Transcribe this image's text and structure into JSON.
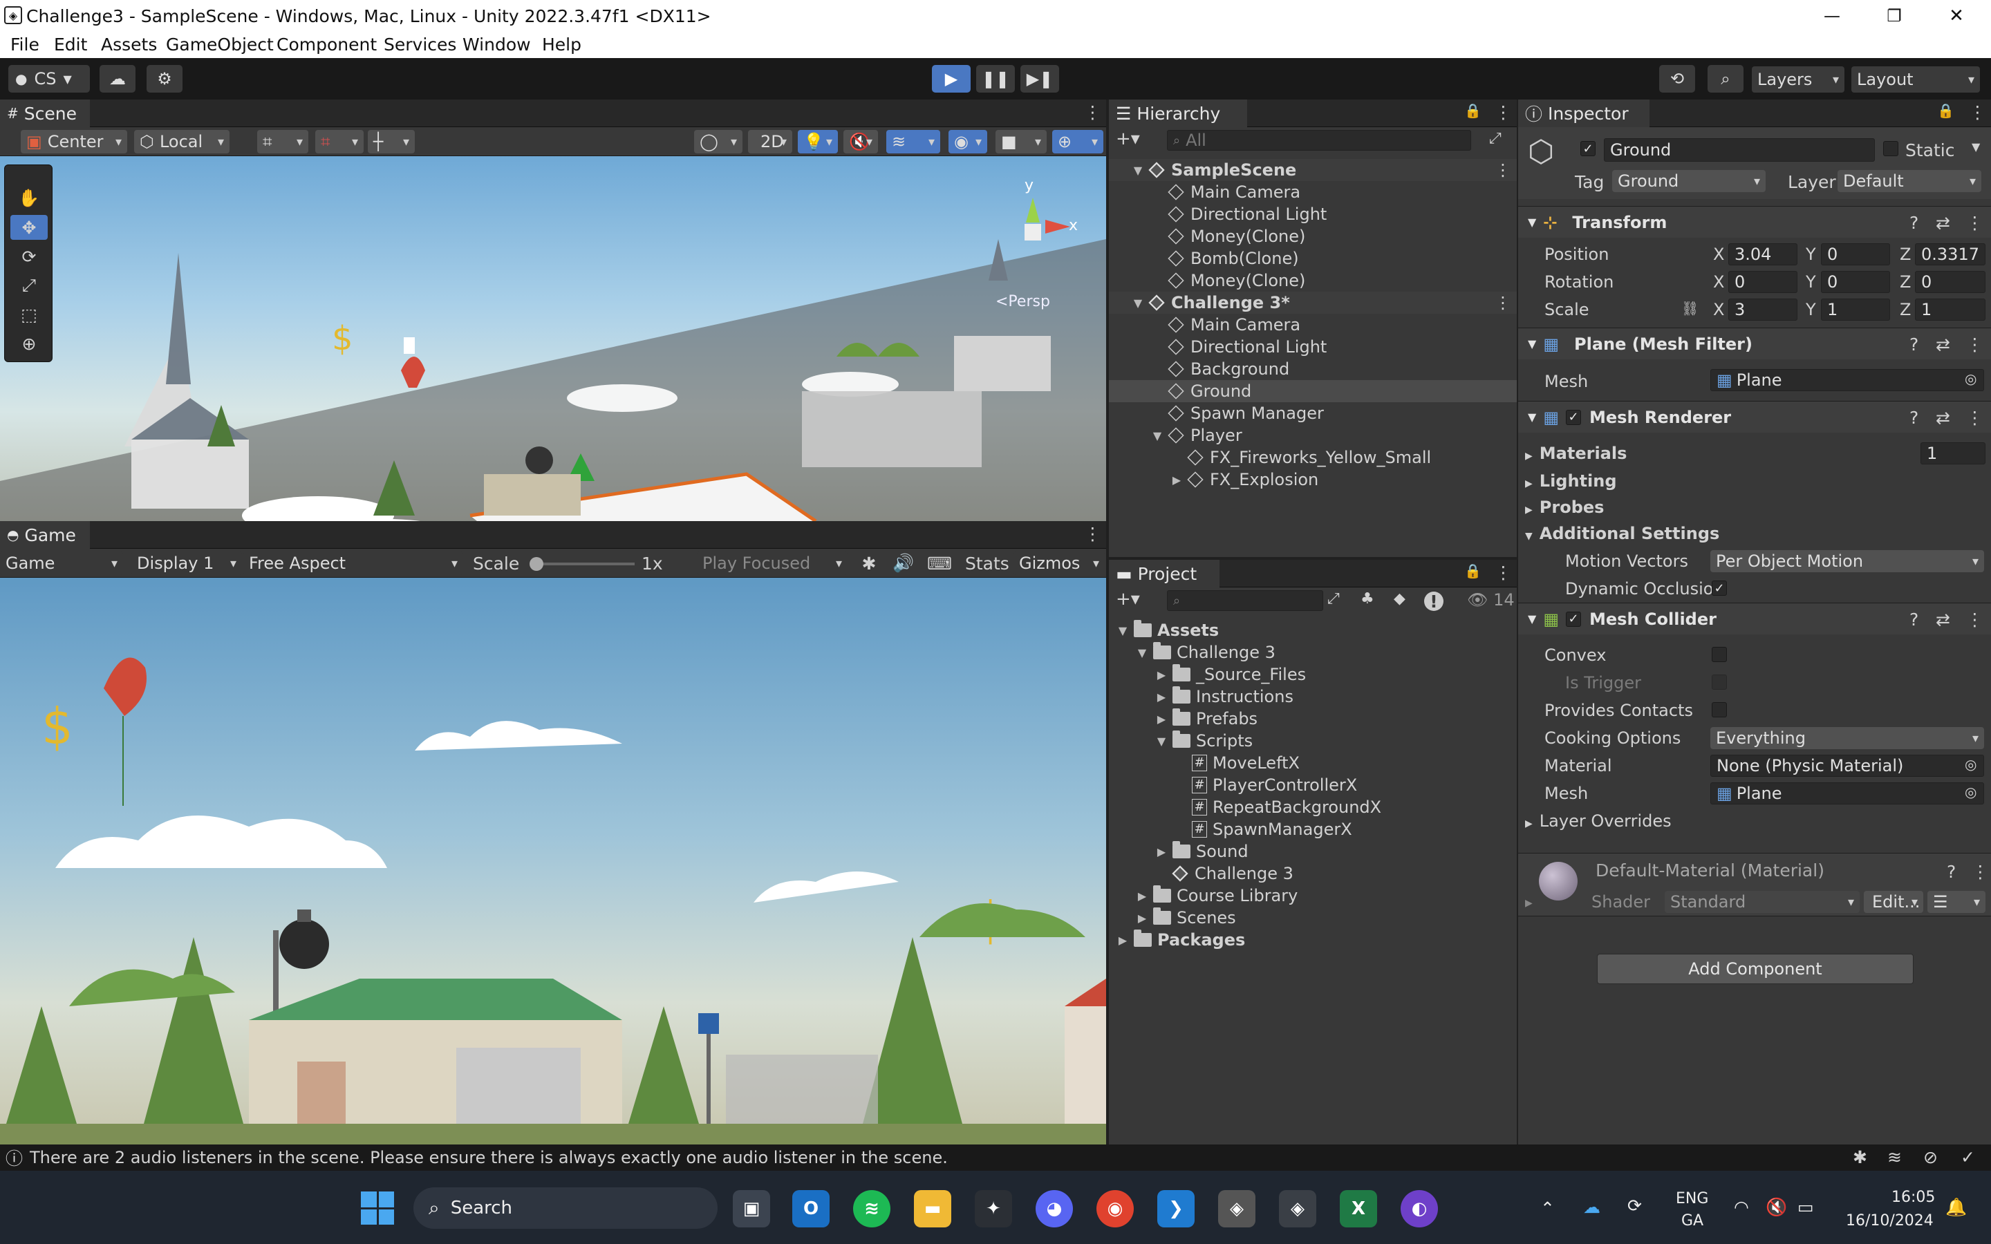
{
  "window": {
    "title": "Challenge3 - SampleScene - Windows, Mac, Linux - Unity 2022.3.47f1 <DX11>",
    "controls": [
      "—",
      "❐",
      "✕"
    ]
  },
  "menu": [
    "File",
    "Edit",
    "Assets",
    "GameObject",
    "Component",
    "Services",
    "Window",
    "Help"
  ],
  "toolbar": {
    "account": "CS",
    "layers": "Layers",
    "layout": "Layout"
  },
  "scene_panel": {
    "tab": "Scene",
    "pivot": "Center",
    "space": "Local",
    "mode_2d": "2D",
    "persp": "<Persp",
    "axis_y": "y",
    "axis_x": "x"
  },
  "game_panel": {
    "tab": "Game",
    "view": "Game",
    "display": "Display 1",
    "aspect": "Free Aspect",
    "scale_label": "Scale",
    "scale_value": "1x",
    "play_focus": "Play Focused",
    "stats": "Stats",
    "gizmos": "Gizmos"
  },
  "hierarchy": {
    "tab": "Hierarchy",
    "search_placeholder": "All",
    "items": [
      {
        "label": "SampleScene",
        "indent": 0,
        "scene": true,
        "expanded": true
      },
      {
        "label": "Main Camera",
        "indent": 1
      },
      {
        "label": "Directional Light",
        "indent": 1
      },
      {
        "label": "Money(Clone)",
        "indent": 1
      },
      {
        "label": "Bomb(Clone)",
        "indent": 1
      },
      {
        "label": "Money(Clone)",
        "indent": 1
      },
      {
        "label": "Challenge 3*",
        "indent": 0,
        "scene": true,
        "expanded": true
      },
      {
        "label": "Main Camera",
        "indent": 1
      },
      {
        "label": "Directional Light",
        "indent": 1
      },
      {
        "label": "Background",
        "indent": 1
      },
      {
        "label": "Ground",
        "indent": 1,
        "selected": true
      },
      {
        "label": "Spawn Manager",
        "indent": 1
      },
      {
        "label": "Player",
        "indent": 1,
        "expanded": true
      },
      {
        "label": "FX_Fireworks_Yellow_Small",
        "indent": 2
      },
      {
        "label": "FX_Explosion",
        "indent": 2,
        "collapsed": true
      }
    ]
  },
  "project": {
    "tab": "Project",
    "hidden_count": "14",
    "items": [
      {
        "label": "Assets",
        "indent": 0,
        "type": "folder",
        "bold": true,
        "expanded": true
      },
      {
        "label": "Challenge 3",
        "indent": 1,
        "type": "folder",
        "expanded": true
      },
      {
        "label": "_Source_Files",
        "indent": 2,
        "type": "folder",
        "collapsed": true
      },
      {
        "label": "Instructions",
        "indent": 2,
        "type": "folder",
        "collapsed": true
      },
      {
        "label": "Prefabs",
        "indent": 2,
        "type": "folder",
        "collapsed": true
      },
      {
        "label": "Scripts",
        "indent": 2,
        "type": "folder",
        "expanded": true
      },
      {
        "label": "MoveLeftX",
        "indent": 3,
        "type": "script"
      },
      {
        "label": "PlayerControllerX",
        "indent": 3,
        "type": "script"
      },
      {
        "label": "RepeatBackgroundX",
        "indent": 3,
        "type": "script"
      },
      {
        "label": "SpawnManagerX",
        "indent": 3,
        "type": "script"
      },
      {
        "label": "Sound",
        "indent": 2,
        "type": "folder",
        "collapsed": true
      },
      {
        "label": "Challenge 3",
        "indent": 2,
        "type": "scene"
      },
      {
        "label": "Course Library",
        "indent": 1,
        "type": "folder",
        "collapsed": true
      },
      {
        "label": "Scenes",
        "indent": 1,
        "type": "folder",
        "collapsed": true
      },
      {
        "label": "Packages",
        "indent": 0,
        "type": "folder",
        "bold": true,
        "collapsed": true
      }
    ]
  },
  "inspector": {
    "tab": "Inspector",
    "object_name": "Ground",
    "static_label": "Static",
    "tag_label": "Tag",
    "tag_value": "Ground",
    "layer_label": "Layer",
    "layer_value": "Default",
    "transform": {
      "title": "Transform",
      "position_label": "Position",
      "rotation_label": "Rotation",
      "scale_label": "Scale",
      "position": [
        "3.04",
        "0",
        "0.3317"
      ],
      "rotation": [
        "0",
        "0",
        "0"
      ],
      "scale": [
        "3",
        "1",
        "1"
      ]
    },
    "mesh_filter": {
      "title": "Plane (Mesh Filter)",
      "mesh_label": "Mesh",
      "mesh_value": "Plane"
    },
    "mesh_renderer": {
      "title": "Mesh Renderer",
      "materials": "Materials",
      "materials_count": "1",
      "lighting": "Lighting",
      "probes": "Probes",
      "additional": "Additional Settings",
      "motion_vectors_label": "Motion Vectors",
      "motion_vectors_value": "Per Object Motion",
      "dynamic_occlusion_label": "Dynamic Occlusio"
    },
    "mesh_collider": {
      "title": "Mesh Collider",
      "convex": "Convex",
      "is_trigger": "Is Trigger",
      "provides_contacts": "Provides Contacts",
      "cooking_label": "Cooking Options",
      "cooking_value": "Everything",
      "material_label": "Material",
      "material_value": "None (Physic Material)",
      "mesh_label": "Mesh",
      "mesh_value": "Plane",
      "layer_overrides": "Layer Overrides"
    },
    "material": {
      "title": "Default-Material (Material)",
      "shader_label": "Shader",
      "shader_value": "Standard",
      "edit": "Edit..."
    },
    "add_component": "Add Component"
  },
  "status": {
    "message": "There are 2 audio listeners in the scene. Please ensure there is always exactly one audio listener in the scene."
  },
  "taskbar": {
    "search": "Search",
    "lang_top": "ENG",
    "lang_bottom": "GA",
    "time": "16:05",
    "date": "16/10/2024"
  },
  "colors": {
    "accent_blue": "#4a78c2",
    "sky_top": "#6fa9d6",
    "sky_bottom": "#cfe2ea",
    "selection": "#4b4b4b"
  }
}
